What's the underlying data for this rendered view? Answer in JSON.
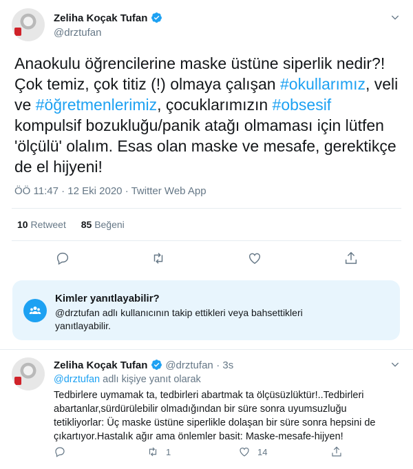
{
  "main_tweet": {
    "author_name": "Zeliha Koçak Tufan",
    "handle": "@drztufan",
    "text": {
      "p1": "Anaokulu öğrencilerine maske üstüne siperlik nedir?! Çok temiz, çok titiz (!) olmaya çalışan ",
      "tag1": "#okullarımız",
      "p2": ", veli ve ",
      "tag2": "#öğretmenlerimiz",
      "p3": ", çocuklarımızın ",
      "tag3": "#obsesif",
      "p4": " kompulsif bozukluğu/panik atağı olmaması için lütfen 'ölçülü' olalım. Esas olan maske ve mesafe, gerektikçe de el hijyeni!"
    },
    "time": "ÖÖ 11:47",
    "date": "12 Eki 2020",
    "source": "Twitter Web App",
    "retweets": "10",
    "retweets_label": "Retweet",
    "likes": "85",
    "likes_label": "Beğeni"
  },
  "reply_restriction": {
    "title": "Kimler yanıtlayabilir?",
    "text": "@drztufan adlı kullanıcının takip ettikleri veya bahsettikleri yanıtlayabilir."
  },
  "reply_tweet": {
    "author_name": "Zeliha Koçak Tufan",
    "handle": "@drztufan",
    "time_ago": "3s",
    "reply_to_handle": "@drztufan",
    "reply_to_label": "adlı kişiye yanıt olarak",
    "text": "Tedbirlere uymamak ta, tedbirleri abartmak ta ölçüsüzlüktür!..Tedbirleri abartanlar,sürdürülebilir olmadığından bir süre sonra uyumsuzluğu tetikliyorlar: Üç maske üstüne siperlikle dolaşan bir süre sonra hepsini de çıkartıyor.Hastalık ağır ama önlemler basit: Maske-mesafe-hijyen!",
    "retweets": "1",
    "likes": "14"
  },
  "colors": {
    "accent": "#1da1f2",
    "secondary_text": "#657786",
    "restriction_bg": "#e8f5fd"
  },
  "icons": [
    "verified-icon",
    "chevron-down-icon",
    "reply-icon",
    "retweet-icon",
    "like-icon",
    "share-icon",
    "people-icon"
  ]
}
